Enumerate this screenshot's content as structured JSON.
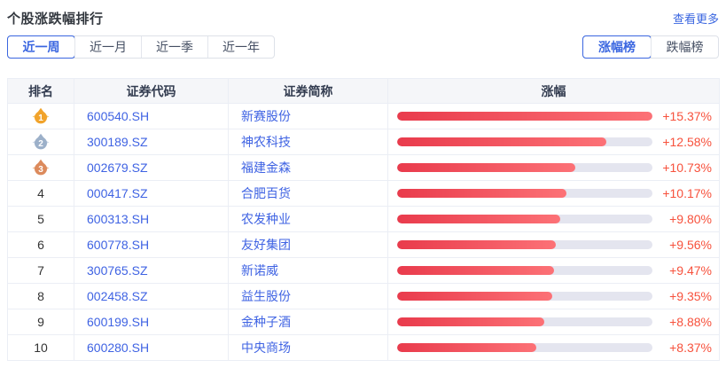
{
  "header": {
    "title": "个股涨跌幅排行",
    "more_link": "查看更多"
  },
  "filters": {
    "period_tabs": [
      {
        "label": "近一周",
        "active": true
      },
      {
        "label": "近一月",
        "active": false
      },
      {
        "label": "近一季",
        "active": false
      },
      {
        "label": "近一年",
        "active": false
      }
    ],
    "rank_type_tabs": [
      {
        "label": "涨幅榜",
        "active": true
      },
      {
        "label": "跌幅榜",
        "active": false
      }
    ]
  },
  "table": {
    "columns": [
      "排名",
      "证券代码",
      "证券简称",
      "涨幅"
    ],
    "rows": [
      {
        "rank": "1",
        "medal": "gold",
        "code": "600540.SH",
        "name": "新赛股份",
        "change": 15.37,
        "change_label": "+15.37%"
      },
      {
        "rank": "2",
        "medal": "silver",
        "code": "300189.SZ",
        "name": "神农科技",
        "change": 12.58,
        "change_label": "+12.58%"
      },
      {
        "rank": "3",
        "medal": "bronze",
        "code": "002679.SZ",
        "name": "福建金森",
        "change": 10.73,
        "change_label": "+10.73%"
      },
      {
        "rank": "4",
        "medal": null,
        "code": "000417.SZ",
        "name": "合肥百货",
        "change": 10.17,
        "change_label": "+10.17%"
      },
      {
        "rank": "5",
        "medal": null,
        "code": "600313.SH",
        "name": "农发种业",
        "change": 9.8,
        "change_label": "+9.80%"
      },
      {
        "rank": "6",
        "medal": null,
        "code": "600778.SH",
        "name": "友好集团",
        "change": 9.56,
        "change_label": "+9.56%"
      },
      {
        "rank": "7",
        "medal": null,
        "code": "300765.SZ",
        "name": "新诺威",
        "change": 9.47,
        "change_label": "+9.47%"
      },
      {
        "rank": "8",
        "medal": null,
        "code": "002458.SZ",
        "name": "益生股份",
        "change": 9.35,
        "change_label": "+9.35%"
      },
      {
        "rank": "9",
        "medal": null,
        "code": "600199.SH",
        "name": "金种子酒",
        "change": 8.88,
        "change_label": "+8.88%"
      },
      {
        "rank": "10",
        "medal": null,
        "code": "600280.SH",
        "name": "中央商场",
        "change": 8.37,
        "change_label": "+8.37%"
      }
    ]
  },
  "colors": {
    "accent_blue": "#3a66e0",
    "pct_red": "#f7513c",
    "header_bg": "#f5f6f9",
    "bar_gradient_start": "#e93b4c",
    "bar_gradient_end": "#fc7176",
    "bar_track": "#e4e5ef",
    "medal_gold": "#f1a32b",
    "medal_silver": "#9cb0c9",
    "medal_bronze": "#dc8a5c"
  }
}
